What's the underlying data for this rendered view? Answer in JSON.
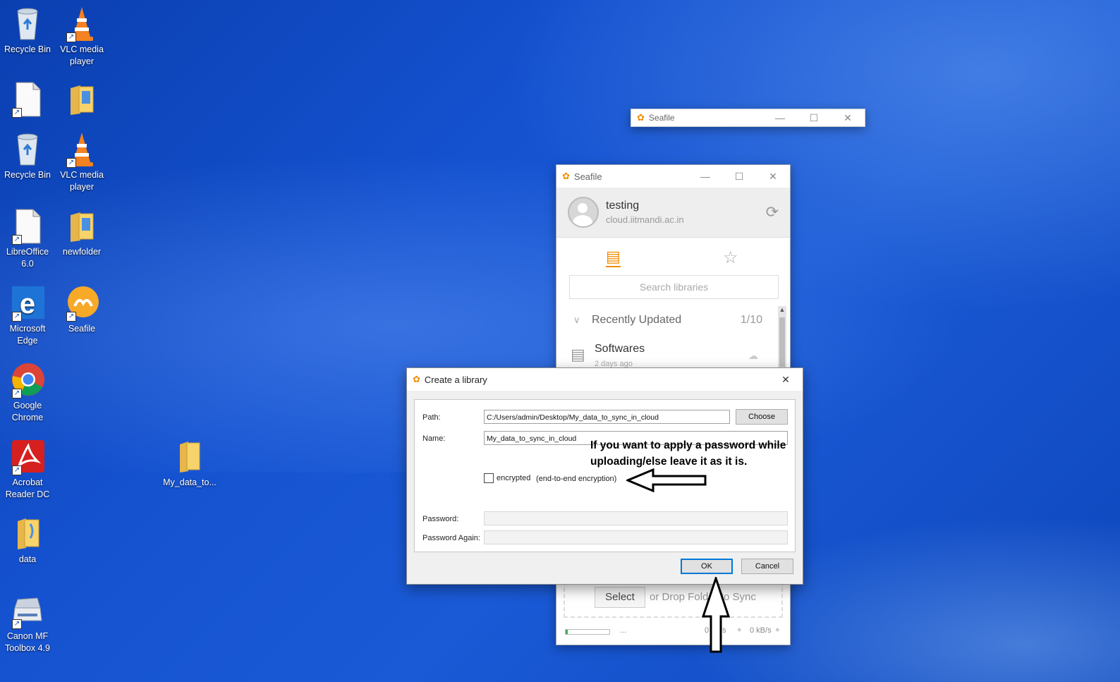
{
  "desktop_icons": [
    {
      "id": "recycle-bin-1",
      "label": "Recycle Bin",
      "icon": "recycle-bin-icon"
    },
    {
      "id": "vlc-1",
      "label": "VLC media player",
      "icon": "vlc-cone-icon"
    },
    {
      "id": "recycle-bin-2",
      "label": "Recycle Bin",
      "icon": "recycle-bin-icon"
    },
    {
      "id": "vlc-2",
      "label": "VLC media player",
      "icon": "vlc-cone-icon"
    },
    {
      "id": "libreoffice",
      "label": "LibreOffice 6.0",
      "icon": "document-icon"
    },
    {
      "id": "newfolder",
      "label": "newfolder",
      "icon": "folder-icon"
    },
    {
      "id": "edge",
      "label": "Microsoft Edge",
      "icon": "edge-icon"
    },
    {
      "id": "seafile",
      "label": "Seafile",
      "icon": "seafile-icon"
    },
    {
      "id": "chrome",
      "label": "Google Chrome",
      "icon": "chrome-icon"
    },
    {
      "id": "acrobat",
      "label": "Acrobat Reader DC",
      "icon": "acrobat-icon"
    },
    {
      "id": "my-data",
      "label": "My_data_to...",
      "icon": "folder-icon"
    },
    {
      "id": "data",
      "label": "data",
      "icon": "folder-icon"
    },
    {
      "id": "canon",
      "label": "Canon MF Toolbox 4.9",
      "icon": "scanner-icon"
    }
  ],
  "seafile_back_window": {
    "title": "Seafile"
  },
  "seafile_main": {
    "title": "Seafile",
    "account_name": "testing",
    "account_server": "cloud.iitmandi.ac.in",
    "search_placeholder": "Search libraries",
    "section_title": "Recently Updated",
    "section_count": "1/10",
    "library_name": "Softwares",
    "library_time": "2 days ago",
    "select_label": "Select",
    "drop_text": "or Drop Folder to Sync",
    "download_rate": "0 kB/s",
    "upload_rate": "0 kB/s",
    "ellipsis": "..."
  },
  "dialog": {
    "title": "Create a library",
    "path_label": "Path:",
    "path_value": "C:/Users/admin/Desktop/My_data_to_sync_in_cloud",
    "choose_label": "Choose",
    "name_label": "Name:",
    "name_value": "My_data_to_sync_in_cloud",
    "encrypted_label": "encrypted",
    "encrypted_hint": "(end-to-end encryption)",
    "encrypted_checked": false,
    "password_label": "Password:",
    "password_again_label": "Password Again:",
    "ok_label": "OK",
    "cancel_label": "Cancel"
  },
  "annotation": {
    "line1": "If you want to apply a password while",
    "line2": "uploading/else leave it as it is."
  },
  "colors": {
    "seafile_orange": "#f28c00",
    "desktop_blue": "#1552d0",
    "focus_blue": "#0078d7"
  }
}
